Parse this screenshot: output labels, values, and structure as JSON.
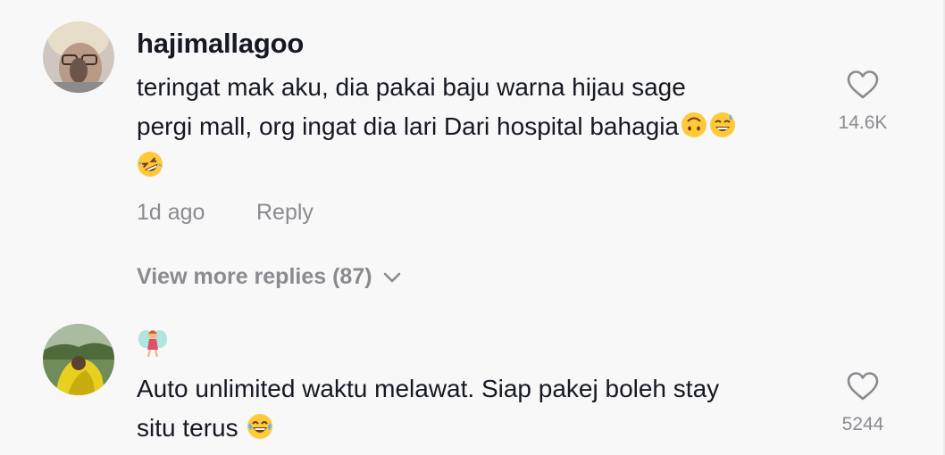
{
  "comments": [
    {
      "username": "hajimallagoo",
      "line1": "teringat mak aku, dia pakai baju warna hijau sage",
      "line2": "pergi mall, org ingat dia lari Dari hospital bahagia",
      "line2_emojis": [
        "upside-down-face",
        "grinning-sweat-face"
      ],
      "line3_emojis": [
        "rolling-laughing-face"
      ],
      "time": "1d ago",
      "reply_label": "Reply",
      "likes": "14.6K"
    },
    {
      "username_emoji": "fairy",
      "line1": "Auto unlimited waktu melawat. Siap pakej boleh stay",
      "line2": "situ terus",
      "line2_emojis": [
        "tears-of-joy-face"
      ],
      "likes": "5244"
    }
  ],
  "view_more_label": "View more replies (87)",
  "colors": {
    "text": "#161823",
    "muted": "#8a8b91",
    "background": "#f8f8f8",
    "emoji_yellow": "#ffca3a"
  }
}
